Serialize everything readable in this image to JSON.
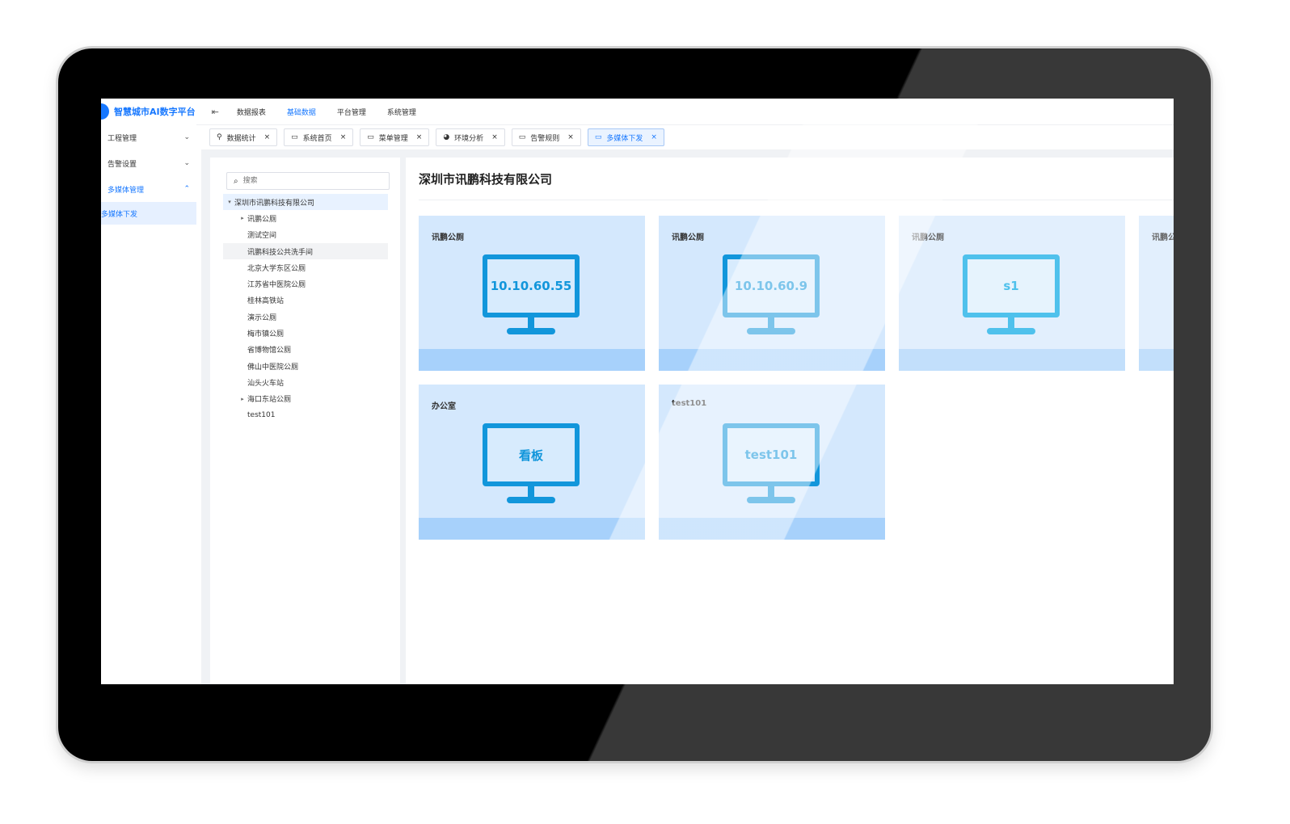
{
  "app": {
    "title": "智慧城市AI数字平台",
    "fold_icon": "menu-fold-icon",
    "nav": [
      "数据报表",
      "基础数据",
      "平台管理",
      "系统管理"
    ],
    "nav_active_index": 1
  },
  "sidemenu": {
    "items": [
      {
        "label": "工程管理",
        "chevron": "⌄"
      },
      {
        "label": "告警设置",
        "chevron": "⌄"
      },
      {
        "label": "多媒体管理",
        "chevron": "⌃"
      }
    ],
    "subitems": [
      {
        "label": "多媒体下发"
      }
    ]
  },
  "tabs": [
    {
      "label": "数据统计",
      "icon": "location-pin-icon",
      "glyph": "⚲",
      "close": "×"
    },
    {
      "label": "系统首页",
      "icon": "window-icon",
      "glyph": "▭",
      "close": "×"
    },
    {
      "label": "菜单管理",
      "icon": "window-icon",
      "glyph": "▭",
      "close": "×"
    },
    {
      "label": "环境分析",
      "icon": "pie-chart-icon",
      "glyph": "◕",
      "close": "×"
    },
    {
      "label": "告警规则",
      "icon": "window-icon",
      "glyph": "▭",
      "close": "×"
    },
    {
      "label": "多媒体下发",
      "icon": "window-icon",
      "glyph": "▭",
      "close": "×"
    }
  ],
  "tabs_active_index": 5,
  "search": {
    "placeholder": "搜索",
    "icon": "search-icon",
    "glyph": "⌕"
  },
  "tree": {
    "root": {
      "label": "深圳市讯鹏科技有限公司",
      "caret": "▾"
    },
    "children": [
      {
        "label": "讯鹏公厕",
        "caret": "▸"
      },
      {
        "label": "测试空间",
        "caret": ""
      },
      {
        "label": "讯鹏科技公共洗手间",
        "caret": ""
      },
      {
        "label": "北京大学东区公厕",
        "caret": ""
      },
      {
        "label": "江苏省中医院公厕",
        "caret": ""
      },
      {
        "label": "桂林高铁站",
        "caret": ""
      },
      {
        "label": "演示公厕",
        "caret": ""
      },
      {
        "label": "梅市镇公厕",
        "caret": ""
      },
      {
        "label": "省博物馆公厕",
        "caret": ""
      },
      {
        "label": "佛山中医院公厕",
        "caret": ""
      },
      {
        "label": "汕头火车站",
        "caret": ""
      },
      {
        "label": "海口东站公厕",
        "caret": "▸"
      },
      {
        "label": "test101",
        "caret": ""
      }
    ]
  },
  "main": {
    "title": "深圳市讯鹏科技有限公司",
    "cards": [
      {
        "name": "讯鹏公厕",
        "screen": "10.10.60.55",
        "status": "online",
        "icon": "monitor-icon"
      },
      {
        "name": "讯鹏公厕",
        "screen": "10.10.60.9",
        "status": "online",
        "icon": "monitor-icon"
      },
      {
        "name": "讯鹏公厕",
        "screen": "s1",
        "status": "offline",
        "icon": "monitor-icon"
      },
      {
        "name": "讯鹏公厕",
        "screen": "",
        "status": "offline",
        "icon": "monitor-icon"
      },
      {
        "name": "办公室",
        "screen": "看板",
        "status": "online",
        "icon": "monitor-icon"
      },
      {
        "name": "test101",
        "screen": "test101",
        "status": "online",
        "icon": "monitor-icon"
      }
    ]
  },
  "colors": {
    "accent": "#1677ff",
    "monitor_online": "#1296db",
    "monitor_offline": "#4fc1ec",
    "card_online": "#d4e8fd",
    "card_offline": "#e2effd",
    "card_footer": "#a7d1fb"
  }
}
